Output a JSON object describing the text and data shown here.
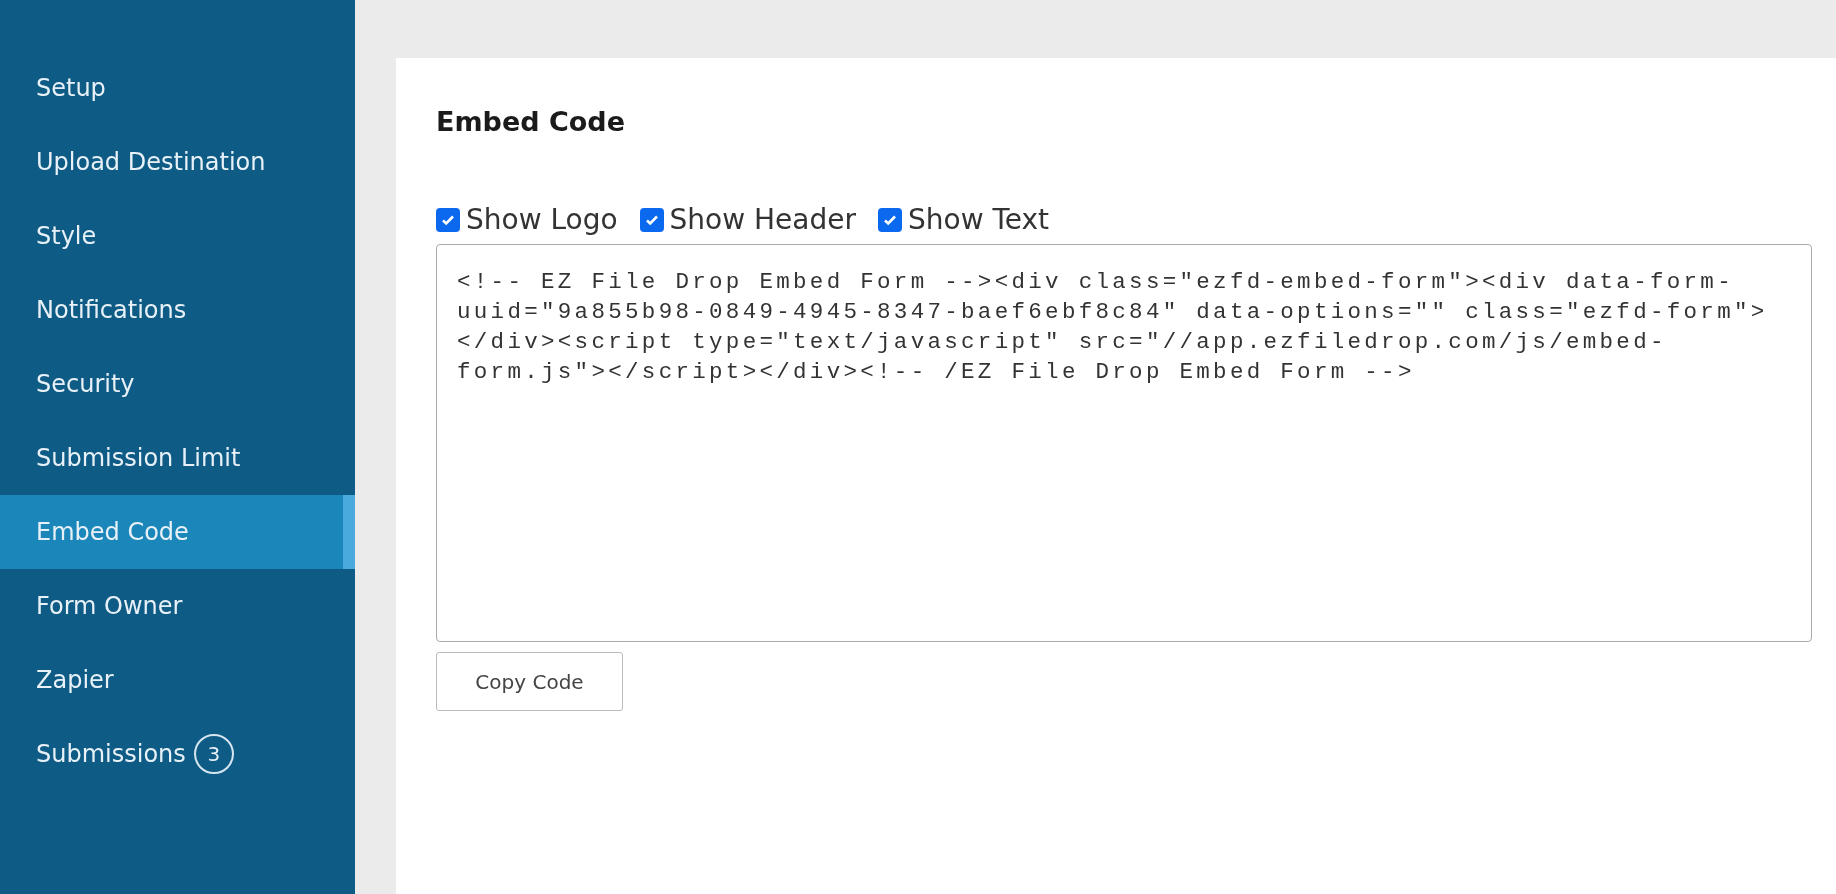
{
  "sidebar": {
    "items": [
      {
        "label": "Setup",
        "selected": false
      },
      {
        "label": "Upload Destination",
        "selected": false
      },
      {
        "label": "Style",
        "selected": false
      },
      {
        "label": "Notifications",
        "selected": false
      },
      {
        "label": "Security",
        "selected": false
      },
      {
        "label": "Submission Limit",
        "selected": false
      },
      {
        "label": "Embed Code",
        "selected": true
      },
      {
        "label": "Form Owner",
        "selected": false
      },
      {
        "label": "Zapier",
        "selected": false
      },
      {
        "label": "Submissions",
        "selected": false,
        "badge": "3"
      }
    ]
  },
  "panel": {
    "title": "Embed Code",
    "options": [
      {
        "label": "Show Logo",
        "checked": true
      },
      {
        "label": "Show Header",
        "checked": true
      },
      {
        "label": "Show Text",
        "checked": true
      }
    ],
    "code_lines": [
      "<!-- EZ File Drop Embed Form --><div class=\"ezfd-embed-form\"><div data-form-",
      "uuid=\"9a855b98-0849-4945-8347-baef6ebf8c84\" data-options=\"\" class=\"ezfd-form\">",
      "</div><script type=\"text/javascript\" src=\"//app.ezfiledrop.com/js/embed-",
      "form.js\"></script></div><!-- /EZ File Drop Embed Form -->"
    ],
    "copy_button": "Copy Code"
  }
}
